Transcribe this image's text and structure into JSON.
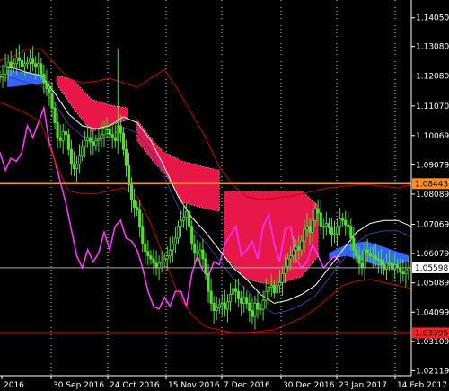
{
  "chart_data": {
    "type": "line",
    "title": "",
    "xlabel": "",
    "ylabel": "",
    "ylim": [
      1.0195,
      1.1465
    ],
    "grid": false,
    "colors": {
      "background": "#000000",
      "axis": "#ffffff",
      "candles": "#55dd33",
      "kumo_bearish": "#e8174a",
      "kumo_bullish": "#3366ff",
      "chikou": "#ff33ff",
      "bands_outer": "#cc0000",
      "ma_inner": "#ffffff",
      "ma_dark": "#3a3aa0",
      "support_line": "#ff1e1e",
      "resistance_line": "#ff8c1a",
      "current_price_line": "#aaaaaa",
      "vgrid": "#ffffff"
    },
    "y_ticks": [
      "1.14050",
      "1.13080",
      "1.12080",
      "1.11070",
      "1.10069",
      "1.09079",
      "1.08089",
      "1.07069",
      "1.06079",
      "1.05089",
      "1.04099",
      "1.03109",
      "1.02119"
    ],
    "x_ticks": [
      "2016",
      "30 Sep 2016",
      "24 Oct 2016",
      "15 Nov 2016",
      "7 Dec 2016",
      "30 Dec 2016",
      "23 Jan 2017",
      "14 Feb 2017"
    ],
    "horizontal_levels": [
      {
        "label": "1.08443",
        "value": 1.08443,
        "role": "resistance",
        "box": "#ff8c1a",
        "text": "#000000"
      },
      {
        "label": "1.05598",
        "value": 1.05598,
        "role": "current",
        "box": "#ffffff",
        "text": "#000000"
      },
      {
        "label": "1.03395",
        "value": 1.03395,
        "role": "support",
        "box": "#ff1e1e",
        "text": "#000000"
      }
    ],
    "series": [
      {
        "type": "candles",
        "color": "#55dd33",
        "x": [
          0,
          3,
          6,
          9,
          12,
          15,
          18,
          21,
          24,
          27,
          30,
          33,
          36,
          39,
          42,
          45,
          48,
          51,
          54,
          57,
          60,
          63,
          66,
          69,
          72,
          75,
          78,
          81,
          84,
          87,
          90,
          93,
          96,
          99,
          102,
          105,
          108,
          111,
          114,
          117,
          120,
          123,
          126,
          129,
          132,
          135,
          138,
          141,
          144,
          147,
          150,
          153,
          156,
          159,
          162,
          165,
          168,
          171,
          174,
          177,
          180,
          183,
          186,
          189,
          192,
          195,
          198,
          201,
          204,
          207,
          210,
          213,
          216,
          219,
          222,
          225,
          228,
          231,
          234,
          237,
          240,
          243,
          246,
          249,
          252,
          255,
          258,
          261,
          264,
          267,
          270,
          273,
          276,
          279,
          282,
          285,
          288,
          291,
          294,
          297,
          300,
          303,
          306,
          309,
          312,
          315,
          318,
          321,
          324,
          327,
          330,
          333,
          336,
          339,
          342,
          345,
          348,
          351,
          354,
          357,
          360,
          363,
          366,
          369,
          372,
          375,
          378,
          381,
          384,
          387,
          390,
          393,
          396,
          399,
          402,
          405,
          408,
          411,
          414,
          417,
          420,
          423,
          426,
          429,
          432,
          435,
          438,
          441,
          444,
          447
        ],
        "close": [
          1.1205,
          1.1215,
          1.124,
          1.1255,
          1.124,
          1.125,
          1.127,
          1.126,
          1.124,
          1.125,
          1.1255,
          1.1265,
          1.125,
          1.124,
          1.125,
          1.1215,
          1.1185,
          1.1165,
          1.115,
          1.11,
          1.105,
          1.1,
          1.099,
          1.102,
          1.101,
          1.096,
          1.091,
          1.0895,
          1.091,
          1.094,
          1.097,
          1.099,
          1.1,
          1.0985,
          1.0975,
          1.099,
          1.0995,
          1.101,
          1.103,
          1.103,
          1.101,
          1.1,
          1.099,
          1.104,
          1.1015,
          1.096,
          1.0905,
          1.084,
          1.079,
          1.0765,
          1.0755,
          1.07,
          1.064,
          1.0615,
          1.06,
          1.059,
          1.0575,
          1.056,
          1.0575,
          1.058,
          1.059,
          1.06,
          1.062,
          1.064,
          1.066,
          1.07,
          1.072,
          1.073,
          1.075,
          1.07,
          1.064,
          1.061,
          1.061,
          1.062,
          1.059,
          1.054,
          1.048,
          1.044,
          1.0415,
          1.0425,
          1.0435,
          1.044,
          1.042,
          1.0445,
          1.047,
          1.049,
          1.048,
          1.0455,
          1.044,
          1.046,
          1.044,
          1.0415,
          1.0395,
          1.044,
          1.042,
          1.042,
          1.045,
          1.048,
          1.0495,
          1.05,
          1.0475,
          1.05,
          1.051,
          1.054,
          1.0565,
          1.059,
          1.06,
          1.062,
          1.063,
          1.062,
          1.065,
          1.069,
          1.07,
          1.068,
          1.072,
          1.076,
          1.0745,
          1.07,
          1.07,
          1.071,
          1.0695,
          1.067,
          1.0675,
          1.07,
          1.0725,
          1.072,
          1.0705,
          1.07,
          1.066,
          1.062,
          1.06,
          1.0575,
          1.056,
          1.062,
          1.061,
          1.06,
          1.06,
          1.059,
          1.0585,
          1.057,
          1.0555,
          1.0575,
          1.0575,
          1.0555,
          1.057,
          1.056,
          1.0545,
          1.054,
          1.055,
          1.056
        ]
      },
      {
        "name": "",
        "role": "chikou",
        "color": "#ff33ff",
        "x": [
          0,
          6,
          12,
          18,
          24,
          30,
          36,
          42,
          48,
          54,
          60,
          66,
          72,
          78,
          84,
          90,
          96,
          102,
          108,
          114,
          120,
          126,
          132,
          138,
          144,
          150,
          156,
          162,
          168,
          174,
          180,
          186,
          192,
          198,
          204,
          210,
          216,
          222,
          228,
          234,
          240,
          246,
          252,
          258,
          264,
          270,
          276,
          282,
          288,
          294,
          300,
          306,
          312,
          318,
          324,
          330,
          336,
          342,
          348,
          354,
          360,
          366,
          372
        ],
        "y": [
          1.095,
          1.089,
          1.093,
          1.092,
          1.095,
          1.104,
          1.1,
          1.105,
          1.11,
          1.098,
          1.092,
          1.085,
          1.078,
          1.069,
          1.06,
          1.056,
          1.062,
          1.058,
          1.061,
          1.068,
          1.062,
          1.07,
          1.072,
          1.066,
          1.065,
          1.062,
          1.056,
          1.048,
          1.043,
          1.042,
          1.046,
          1.043,
          1.048,
          1.048,
          1.043,
          1.054,
          1.06,
          1.055,
          1.053,
          1.058,
          1.057,
          1.064,
          1.067,
          1.07,
          1.06,
          1.062,
          1.065,
          1.059,
          1.07,
          1.074,
          1.064,
          1.058,
          1.069,
          1.07,
          1.059,
          1.056,
          1.058,
          1.064,
          1.06,
          1.056,
          1.058,
          1.06,
          1.058
        ]
      },
      {
        "name": "",
        "role": "upper-band",
        "color": "#cc0000",
        "x": [
          0,
          15,
          30,
          45,
          60,
          75,
          90,
          105,
          120,
          135,
          150,
          165,
          180,
          195,
          210,
          225,
          240,
          255,
          270,
          285,
          300,
          315,
          330,
          345,
          360,
          375,
          390,
          405,
          420,
          435,
          450
        ],
        "y": [
          1.126,
          1.1275,
          1.13,
          1.13,
          1.125,
          1.12,
          1.1185,
          1.119,
          1.12,
          1.1185,
          1.117,
          1.12,
          1.123,
          1.116,
          1.108,
          1.1,
          1.09,
          1.084,
          1.08,
          1.079,
          1.0795,
          1.08,
          1.081,
          1.082,
          1.083,
          1.0835,
          1.084,
          1.084,
          1.0835,
          1.083,
          1.084
        ]
      },
      {
        "name": "",
        "role": "lower-band",
        "color": "#cc0000",
        "x": [
          0,
          15,
          30,
          45,
          60,
          75,
          90,
          105,
          120,
          135,
          150,
          165,
          180,
          195,
          210,
          225,
          240,
          255,
          270,
          285,
          300,
          315,
          330,
          345,
          360,
          375,
          390,
          405,
          420,
          435,
          450
        ],
        "y": [
          1.112,
          1.11,
          1.108,
          1.105,
          1.092,
          1.082,
          1.081,
          1.081,
          1.082,
          1.083,
          1.08,
          1.071,
          1.059,
          1.047,
          1.04,
          1.036,
          1.035,
          1.034,
          1.034,
          1.0345,
          1.035,
          1.037,
          1.039,
          1.042,
          1.046,
          1.05,
          1.0515,
          1.052,
          1.051,
          1.05,
          1.049
        ]
      },
      {
        "name": "",
        "role": "mid-line",
        "color": "#ffffff",
        "x": [
          0,
          15,
          30,
          45,
          60,
          75,
          90,
          105,
          120,
          135,
          150,
          165,
          180,
          195,
          210,
          225,
          240,
          255,
          270,
          285,
          300,
          315,
          330,
          345,
          360,
          375,
          390,
          405,
          420,
          435,
          450
        ],
        "y": [
          1.124,
          1.1235,
          1.122,
          1.121,
          1.115,
          1.108,
          1.104,
          1.103,
          1.104,
          1.107,
          1.105,
          1.099,
          1.09,
          1.08,
          1.073,
          1.068,
          1.062,
          1.056,
          1.052,
          1.047,
          1.044,
          1.045,
          1.047,
          1.05,
          1.056,
          1.062,
          1.068,
          1.071,
          1.072,
          1.072,
          1.07
        ]
      }
    ],
    "kumo": [
      {
        "sentiment": "bullish",
        "x": [
          8,
          50
        ],
        "top": [
          1.123,
          1.121
        ],
        "bottom": [
          1.117,
          1.1185
        ]
      },
      {
        "sentiment": "bearish",
        "x": [
          62,
          80,
          100,
          120,
          140
        ],
        "top": [
          1.121,
          1.1195,
          1.113,
          1.111,
          1.11
        ],
        "bottom": [
          1.118,
          1.11,
          1.102,
          1.104,
          1.106
        ]
      },
      {
        "sentiment": "bearish",
        "x": [
          150,
          170,
          180,
          200,
          225,
          240
        ],
        "top": [
          1.106,
          1.098,
          1.095,
          1.092,
          1.09,
          1.089
        ],
        "bottom": [
          1.099,
          1.091,
          1.088,
          1.078,
          1.076,
          1.075
        ]
      },
      {
        "sentiment": "bearish",
        "x": [
          245,
          270,
          300,
          330,
          348
        ],
        "top": [
          1.082,
          1.082,
          1.082,
          1.082,
          1.077
        ],
        "bottom": [
          1.06,
          1.052,
          1.05,
          1.053,
          1.06
        ]
      },
      {
        "sentiment": "bullish",
        "x": [
          360,
          380,
          400,
          420,
          448
        ],
        "top": [
          1.061,
          1.064,
          1.065,
          1.063,
          1.06
        ],
        "bottom": [
          1.059,
          1.06,
          1.058,
          1.056,
          1.058
        ]
      }
    ]
  }
}
